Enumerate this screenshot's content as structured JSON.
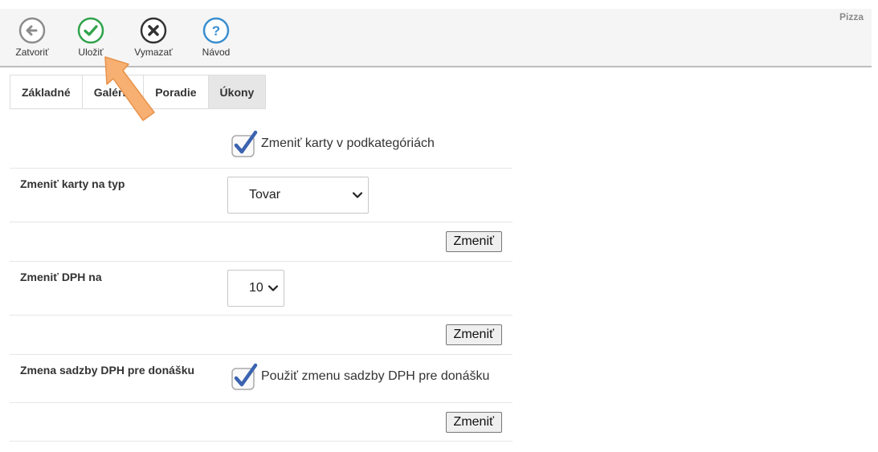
{
  "toolbar": {
    "buttons": [
      {
        "label": "Zatvoriť",
        "icon": "back-arrow-icon",
        "color": "#8c8c8c"
      },
      {
        "label": "Uložiť",
        "icon": "check-icon",
        "color": "#2fa34a"
      },
      {
        "label": "Vymazať",
        "icon": "delete-x-icon",
        "color": "#333333"
      },
      {
        "label": "Návod",
        "icon": "help-icon",
        "color": "#3a8fd0"
      }
    ],
    "page_name": "Pizza"
  },
  "tabs": [
    {
      "label": "Základné",
      "active": false
    },
    {
      "label": "Galéria",
      "active": false
    },
    {
      "label": "Poradie",
      "active": false
    },
    {
      "label": "Úkony",
      "active": true
    }
  ],
  "form": {
    "subcategories_checkbox": {
      "label": "Zmeniť karty v podkategóriách",
      "checked": true
    },
    "card_type": {
      "label": "Zmeniť karty na typ",
      "value": "Tovar"
    },
    "change_button_1": "Zmeniť",
    "vat": {
      "label": "Zmeniť DPH na",
      "value": "10"
    },
    "change_button_2": "Zmeniť",
    "delivery_vat": {
      "label": "Zmena sadzby DPH pre donášku",
      "checkbox_label": "Použiť zmenu sadzby DPH pre donášku",
      "checked": true
    },
    "change_button_3": "Zmeniť"
  },
  "colors": {
    "toolbar_bg": "#f5f5f5",
    "active_tab_bg": "#e6e6e6",
    "checkbox_check": "#3b63b0",
    "pointer_arrow": "#f7b071"
  }
}
